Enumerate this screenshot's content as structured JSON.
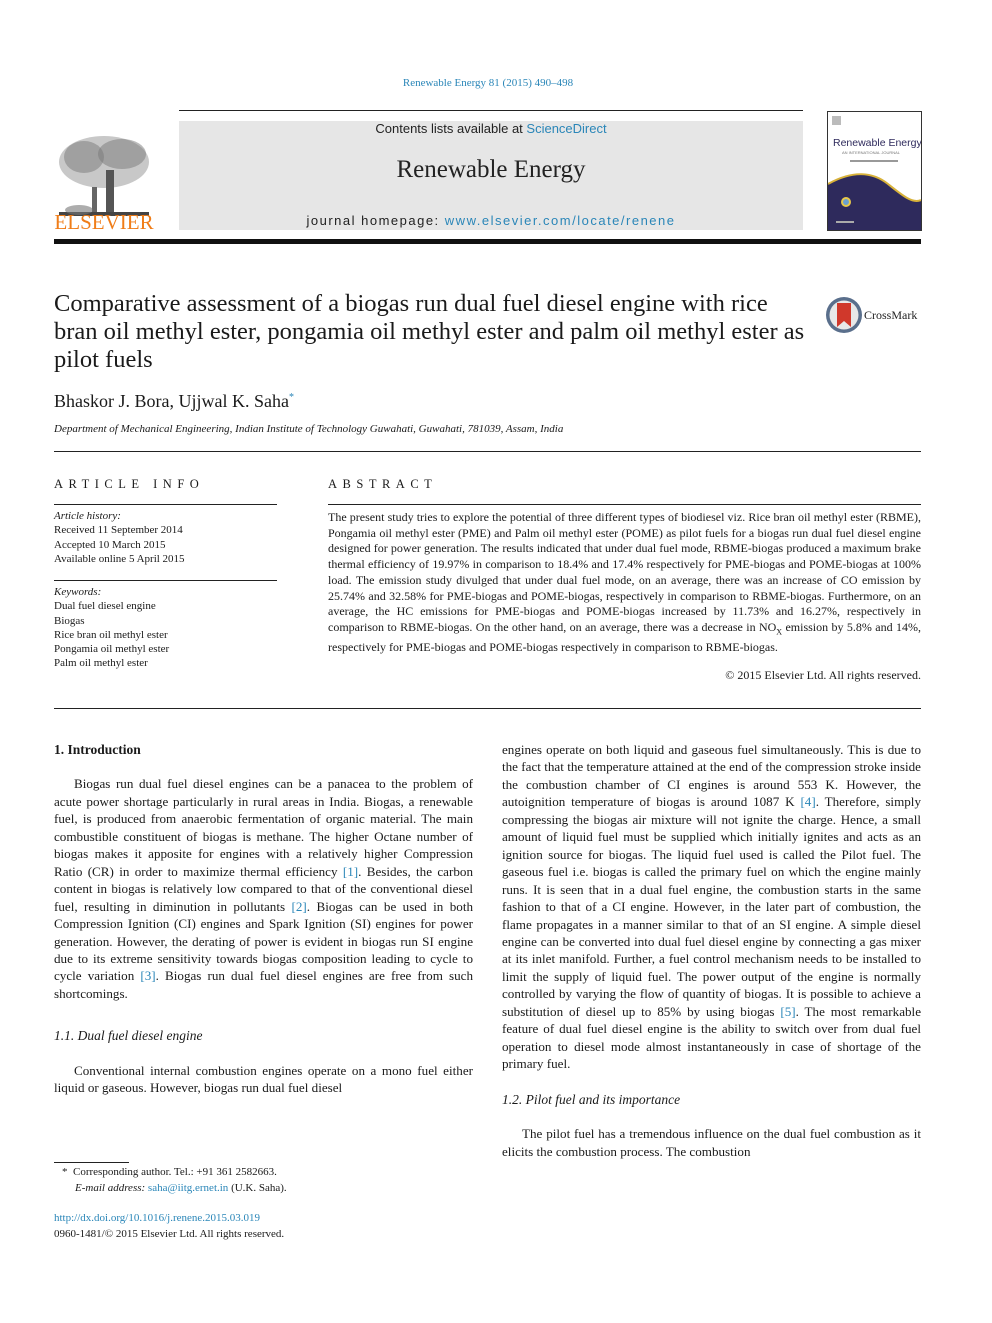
{
  "header": {
    "journal_ref": "Renewable Energy 81 (2015) 490–498",
    "contents_prefix": "Contents lists available at ",
    "contents_link": "ScienceDirect",
    "journal_name": "Renewable Energy",
    "homepage_prefix": "journal homepage: ",
    "homepage_link": "www.elsevier.com/locate/renene",
    "publisher_logo_text": "ELSEVIER",
    "cover_title": "Renewable Energy",
    "cover_subtitle": "AN INTERNATIONAL JOURNAL",
    "crossmark_label": "CrossMark"
  },
  "article": {
    "title": "Comparative assessment of a biogas run dual fuel diesel engine with rice bran oil methyl ester, pongamia oil methyl ester and palm oil methyl ester as pilot fuels",
    "authors": "Bhaskor J. Bora, Ujjwal K. Saha",
    "author_mark": "*",
    "affiliation": "Department of Mechanical Engineering, Indian Institute of Technology Guwahati, Guwahati, 781039, Assam, India"
  },
  "article_info": {
    "heading": "ARTICLE INFO",
    "history_label": "Article history:",
    "history": [
      "Received 11 September 2014",
      "Accepted 10 March 2015",
      "Available online 5 April 2015"
    ],
    "keywords_label": "Keywords:",
    "keywords": [
      "Dual fuel diesel engine",
      "Biogas",
      "Rice bran oil methyl ester",
      "Pongamia oil methyl ester",
      "Palm oil methyl ester"
    ]
  },
  "abstract": {
    "heading": "ABSTRACT",
    "text_before_nox": "The present study tries to explore the potential of three different types of biodiesel viz. Rice bran oil methyl ester (RBME), Pongamia oil methyl ester (PME) and Palm oil methyl ester (POME) as pilot fuels for a biogas run dual fuel diesel engine designed for power generation. The results indicated that under dual fuel mode, RBME-biogas produced a maximum brake thermal efficiency of 19.97% in comparison to 18.4% and 17.4% respectively for PME-biogas and POME-biogas at 100% load. The emission study divulged that under dual fuel mode, on an average, there was an increase of CO emission by 25.74% and 32.58% for PME-biogas and POME-biogas, respectively in comparison to RBME-biogas. Furthermore, on an average, the HC emissions for PME-biogas and POME-biogas increased by 11.73% and 16.27%, respectively in comparison to RBME-biogas. On the other hand, on an average, there was a decrease in NO",
    "nox_sub": "X",
    "text_after_nox": " emission by 5.8% and 14%, respectively for PME-biogas and POME-biogas respectively in comparison to RBME-biogas.",
    "copyright": "© 2015 Elsevier Ltd. All rights reserved."
  },
  "body": {
    "sec1_heading": "1.  Introduction",
    "sec1_p1": [
      "Biogas run dual fuel diesel engines can be a panacea to the problem of acute power shortage particularly in rural areas in India. Biogas, a renewable fuel, is produced from anaerobic fermentation of organic material. The main combustible constituent of biogas is methane. The higher Octane number of biogas makes it apposite for engines with a relatively higher Compression Ratio (CR) in order to maximize thermal efficiency ",
      "[1]",
      ". Besides, the carbon content in biogas is relatively low compared to that of the conventional diesel fuel, resulting in diminution in pollutants ",
      "[2]",
      ". Biogas can be used in both Compression Ignition (CI) engines and Spark Ignition (SI) engines for power generation. However, the derating of power is evident in biogas run SI engine due to its extreme sensitivity towards biogas composition leading to cycle to cycle variation ",
      "[3]",
      ". Biogas run dual fuel diesel engines are free from such shortcomings."
    ],
    "sec11_heading": "1.1.  Dual fuel diesel engine",
    "sec11_p1_left": "Conventional internal combustion engines operate on a mono fuel either liquid or gaseous. However, biogas run dual fuel diesel",
    "sec11_p1_right": [
      "engines operate on both liquid and gaseous fuel simultaneously. This is due to the fact that the temperature attained at the end of the compression stroke inside the combustion chamber of CI engines is around 553 K. However, the autoignition temperature of biogas is around 1087 K ",
      "[4]",
      ". Therefore, simply compressing the biogas air mixture will not ignite the charge. Hence, a small amount of liquid fuel must be supplied which initially ignites and acts as an ignition source for biogas. The liquid fuel used is called the Pilot fuel. The gaseous fuel i.e. biogas is called the primary fuel on which the engine mainly runs. It is seen that in a dual fuel engine, the combustion starts in the same fashion to that of a CI engine. However, in the later part of combustion, the flame propagates in a manner similar to that of an SI engine. A simple diesel engine can be converted into dual fuel diesel engine by connecting a gas mixer at its inlet manifold. Further, a fuel control mechanism needs to be installed to limit the supply of liquid fuel. The power output of the engine is normally controlled by varying the flow of quantity of biogas. It is possible to achieve a substitution of diesel up to 85% by using biogas ",
      "[5]",
      ". The most remarkable feature of dual fuel diesel engine is the ability to switch over from dual fuel operation to diesel mode almost instantaneously in case of shortage of the primary fuel."
    ],
    "sec12_heading": "1.2.  Pilot fuel and its importance",
    "sec12_p1": "The pilot fuel has a tremendous influence on the dual fuel combustion as it elicits the combustion process. The combustion"
  },
  "footnote": {
    "marker": "*",
    "line1": "Corresponding author. Tel.: +91 361 2582663.",
    "email_label": "E-mail address: ",
    "email": "saha@iitg.ernet.in",
    "email_suffix": " (U.K. Saha)."
  },
  "doi": {
    "link": "http://dx.doi.org/10.1016/j.renene.2015.03.019",
    "issn_line": "0960-1481/© 2015 Elsevier Ltd. All rights reserved."
  },
  "colors": {
    "link": "#2a86b8",
    "elsevier_orange": "#f07d18",
    "masthead_bg": "#e6e6e6",
    "cover_navy": "#2e2a5c",
    "cover_gold": "#d8b23a"
  }
}
